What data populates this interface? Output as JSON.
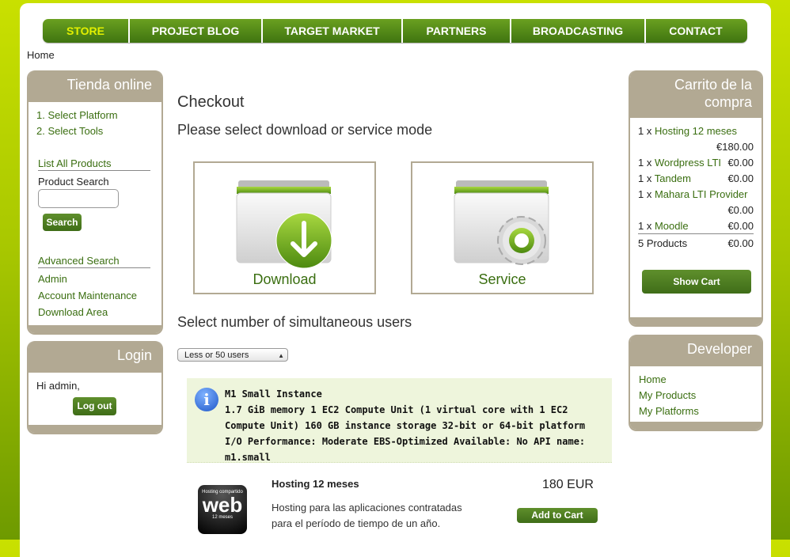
{
  "nav": [
    "STORE",
    "PROJECT BLOG",
    "TARGET MARKET",
    "PARTNERS",
    "BROADCASTING",
    "CONTACT"
  ],
  "breadcrumb": "Home",
  "store_box": {
    "title": "Tienda online",
    "steps": [
      "1. Select Platform",
      "2. Select Tools"
    ],
    "list_all": "List All Products",
    "product_search": "Product Search",
    "search_button": "Search",
    "advanced_search": "Advanced Search",
    "links": [
      "Admin",
      "Account Maintenance",
      "Download Area"
    ]
  },
  "login_box": {
    "title": "Login",
    "greeting": "Hi admin,",
    "logout_button": "Log out"
  },
  "main": {
    "title": "Checkout",
    "subtitle": "Please select download or service mode",
    "download_label": "Download",
    "service_label": "Service",
    "users_heading": "Select number of simultaneous users",
    "users_select": "Less or 50 users",
    "info_title": "M1 Small Instance",
    "info_body": "1.7 GiB memory 1 EC2 Compute Unit (1 virtual core with 1 EC2 Compute Unit) 160 GB instance storage 32-bit or 64-bit platform I/O Performance: Moderate EBS-Optimized Available: No API name: m1.small",
    "product": {
      "badge_top": "Hosting compartido",
      "badge_main": "web",
      "badge_bottom": "12 meses",
      "title": "Hosting 12 meses",
      "desc": "Hosting para las aplicaciones contratadas para el período de tiempo de un año.",
      "price": "180 EUR",
      "add_button": "Add to Cart"
    }
  },
  "cart_box": {
    "title": "Carrito de la compra",
    "items": [
      {
        "qty": "1 x",
        "name": "Hosting 12 meses",
        "price": "€180.00"
      },
      {
        "qty": "1 x",
        "name": "Wordpress LTI",
        "price": "€0.00"
      },
      {
        "qty": "1 x",
        "name": "Tandem",
        "price": "€0.00"
      },
      {
        "qty": "1 x",
        "name": "Mahara LTI Provider",
        "price": "€0.00"
      },
      {
        "qty": "1 x",
        "name": "Moodle",
        "price": "€0.00"
      }
    ],
    "total_label": "5 Products",
    "total_price": "€0.00",
    "show_cart_button": "Show Cart"
  },
  "developer_box": {
    "title": "Developer",
    "links": [
      "Home",
      "My Products",
      "My Platforms"
    ]
  },
  "colors": {
    "accent": "#3a6e10",
    "box": "#b2a993",
    "nav": "#4f8618"
  },
  "icons": [
    "download-icon",
    "gear-icon",
    "info-icon",
    "folder-icon"
  ]
}
